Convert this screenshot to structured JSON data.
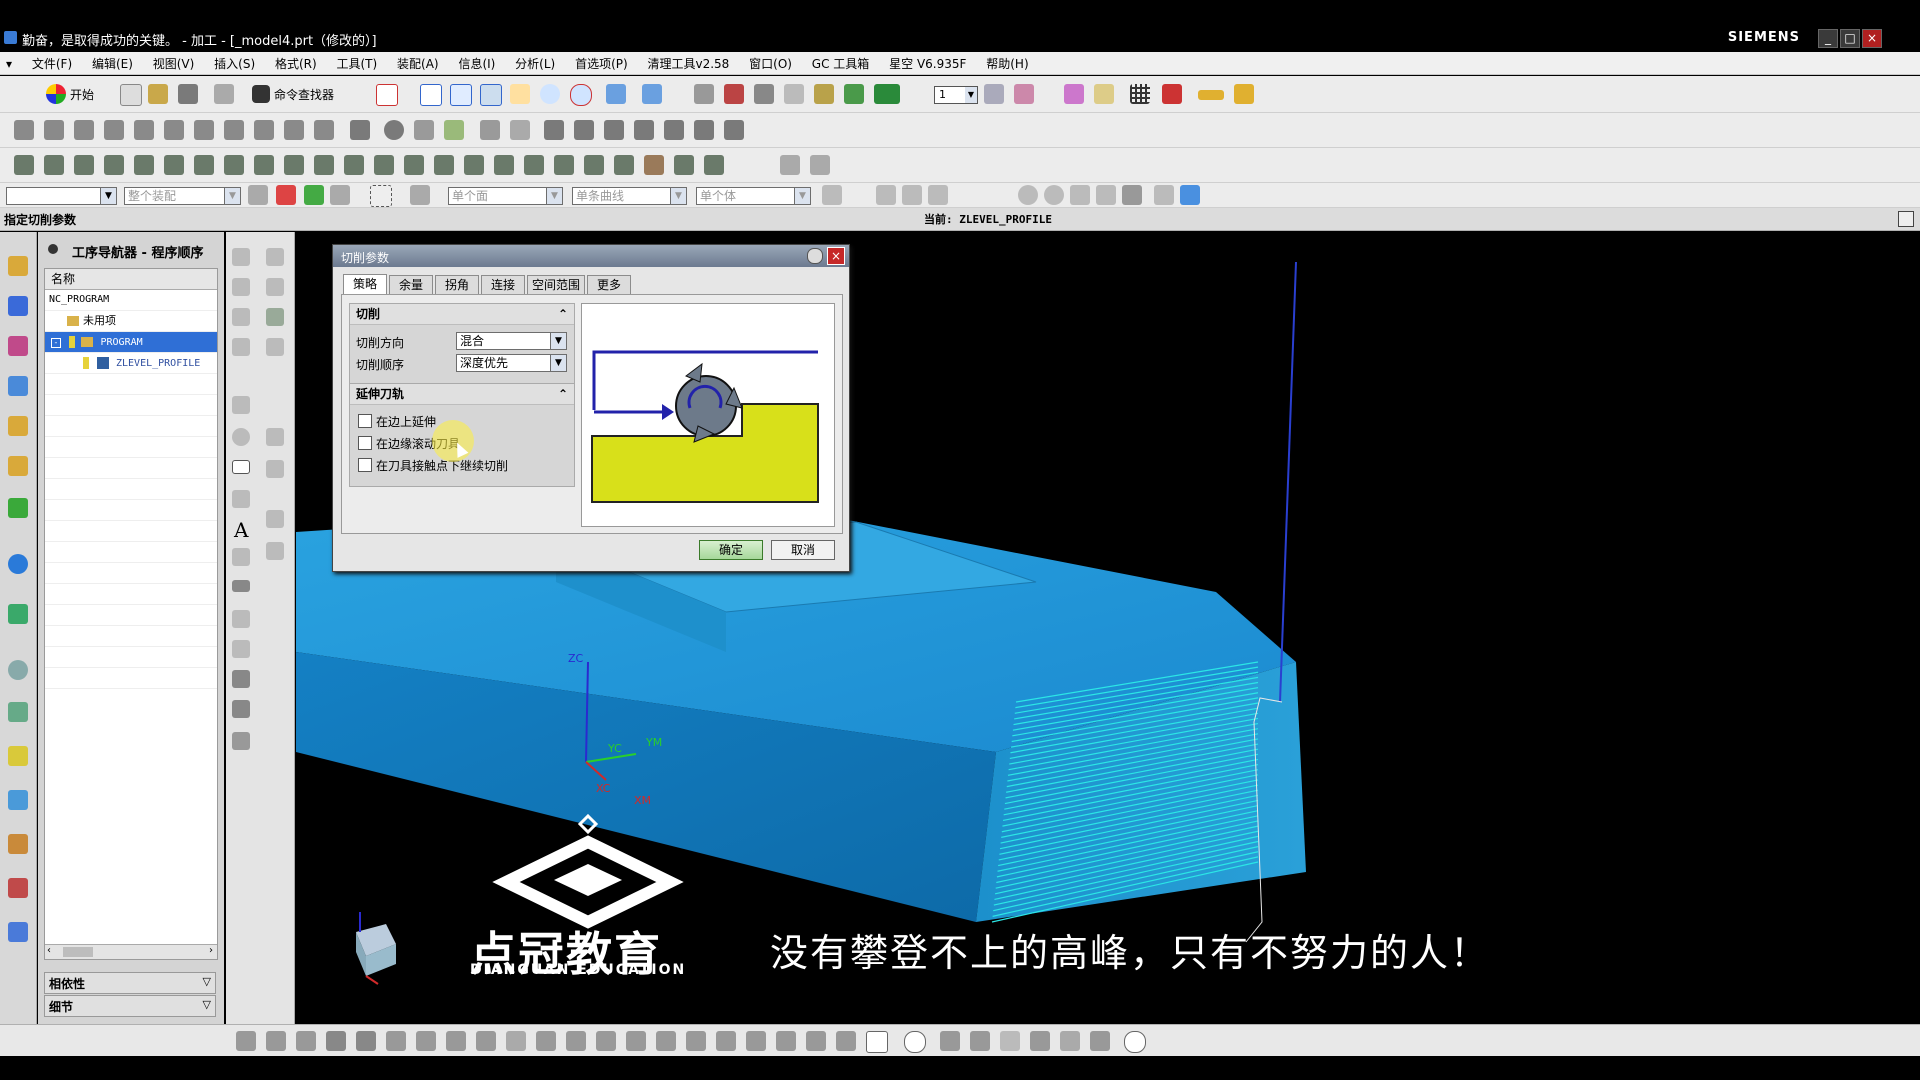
{
  "window": {
    "title": "勤奋，是取得成功的关键。 - 加工 - [_model4.prt（修改的）]",
    "brand": "SIEMENS",
    "min": "_",
    "max": "□",
    "close": "×"
  },
  "menu": [
    "文件(F)",
    "编辑(E)",
    "视图(V)",
    "插入(S)",
    "格式(R)",
    "工具(T)",
    "装配(A)",
    "信息(I)",
    "分析(L)",
    "首选项(P)",
    "清理工具v2.58",
    "窗口(O)",
    "GC 工具箱",
    "星空 V6.935F",
    "帮助(H)"
  ],
  "toolbar": {
    "start_label": "开始",
    "command_finder": "命令查找器",
    "layer_value": "1"
  },
  "selection_bar": {
    "filter1": "",
    "filter2": "整个装配",
    "filter3": "单个面",
    "filter4": "单条曲线",
    "filter5": "单个体"
  },
  "cue": {
    "prompt": "指定切削参数",
    "current": "当前: ZLEVEL_PROFILE"
  },
  "navigator": {
    "title": "工序导航器 - 程序顺序",
    "column": "名称",
    "items": [
      "NC_PROGRAM",
      "未用项",
      "PROGRAM",
      "ZLEVEL_PROFILE"
    ],
    "panel1": "相依性",
    "panel2": "细节"
  },
  "dialog": {
    "title": "切削参数",
    "tabs": [
      "策略",
      "余量",
      "拐角",
      "连接",
      "空间范围",
      "更多"
    ],
    "section_cut": "切削",
    "cut_direction_label": "切削方向",
    "cut_direction_value": "混合",
    "cut_order_label": "切削顺序",
    "cut_order_value": "深度优先",
    "section_extend": "延伸刀轨",
    "check1": "在边上延伸",
    "check2": "在边缘滚动刀具",
    "check3": "在刀具接触点下继续切削",
    "ok": "确定",
    "cancel": "取消"
  },
  "viewport": {
    "axis_x": "XC",
    "axis_y": "YC",
    "axis_z": "ZC",
    "axis_xm": "XM",
    "axis_ym": "YM"
  },
  "overlay": {
    "logo_cn": "点冠教育",
    "logo_en": "DIANGUAN EDUCATION",
    "subtitle": "没有攀登不上的高峰，只有不努力的人！"
  },
  "colors": {
    "selection": "#2f6fd6",
    "part": "#1d8fd0",
    "toolpath": "#2be6e6",
    "preview_yellow": "#d8e01a",
    "preview_blue": "#2222aa"
  }
}
